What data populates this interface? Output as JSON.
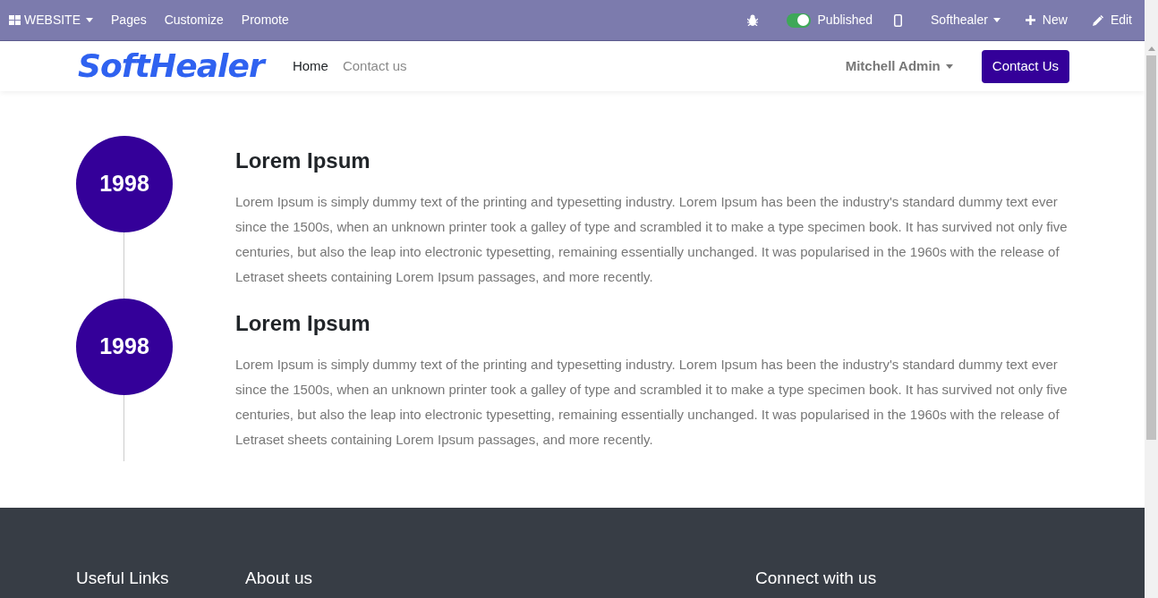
{
  "admin_bar": {
    "website_menu": "WEBSITE",
    "menu": [
      "Pages",
      "Customize",
      "Promote"
    ],
    "published": {
      "label": "Published",
      "on": true
    },
    "company": "Softhealer",
    "new": "New",
    "edit": "Edit"
  },
  "navbar": {
    "logo": "SoftHealer",
    "links": [
      {
        "label": "Home",
        "selected": true
      },
      {
        "label": "Contact us",
        "selected": false
      }
    ],
    "user": "Mitchell Admin",
    "cta": "Contact Us"
  },
  "timeline": [
    {
      "year": "1998",
      "title": "Lorem Ipsum",
      "text": "Lorem Ipsum is simply dummy text of the printing and typesetting industry. Lorem Ipsum has been the industry's standard dummy text ever since the 1500s, when an unknown printer took a galley of type and scrambled it to make a type specimen book. It has survived not only five centuries, but also the leap into electronic typesetting, remaining essentially unchanged. It was popularised in the 1960s with the release of Letraset sheets containing Lorem Ipsum passages, and more recently."
    },
    {
      "year": "1998",
      "title": "Lorem Ipsum",
      "text": "Lorem Ipsum is simply dummy text of the printing and typesetting industry. Lorem Ipsum has been the industry's standard dummy text ever since the 1500s, when an unknown printer took a galley of type and scrambled it to make a type specimen book. It has survived not only five centuries, but also the leap into electronic typesetting, remaining essentially unchanged. It was popularised in the 1960s with the release of Letraset sheets containing Lorem Ipsum passages, and more recently."
    }
  ],
  "footer": {
    "headings": [
      "Useful Links",
      "About us",
      "Connect with us"
    ]
  }
}
